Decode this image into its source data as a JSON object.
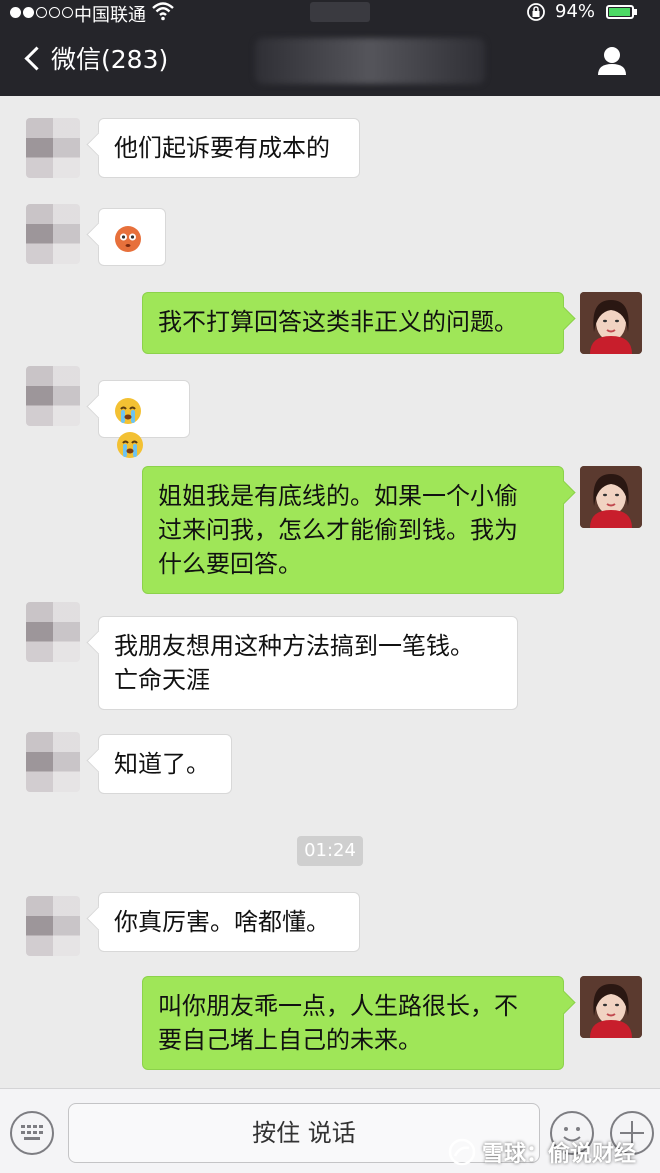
{
  "status_bar": {
    "carrier": "中国联通",
    "battery_percent": "94%",
    "battery_level": 0.94
  },
  "nav": {
    "back_label": "微信(283)"
  },
  "messages": [
    {
      "side": "left",
      "text": "他们起诉要有成本的"
    },
    {
      "side": "left",
      "emoji": [
        "flushed-face-emoji"
      ]
    },
    {
      "side": "right",
      "text": "我不打算回答这类非正义的问题。"
    },
    {
      "side": "left",
      "emoji": [
        "crying-face-emoji",
        "crying-face-emoji"
      ]
    },
    {
      "side": "right",
      "lines": [
        "姐姐我是有底线的。如果一个小偷",
        "过来问我，怎么才能偷到钱。我为",
        "什么要回答。"
      ]
    },
    {
      "side": "left",
      "lines": [
        "我朋友想用这种方法搞到一笔钱。",
        "亡命天涯"
      ]
    },
    {
      "side": "left",
      "text": "知道了。"
    },
    {
      "side": "left",
      "text": "你真厉害。啥都懂。"
    },
    {
      "side": "right",
      "lines": [
        "叫你朋友乖一点，人生路很长，不",
        "要自己堵上自己的未来。"
      ]
    }
  ],
  "timestamp": "01:24",
  "input_bar": {
    "hold_to_talk_label": "按住 说话"
  },
  "watermark": {
    "text": "雪球：偷说财经"
  },
  "colors": {
    "nav_bg": "#25252a",
    "chat_bg": "#ebebeb",
    "bubble_right": "#9fe658",
    "bubble_left": "#ffffff"
  }
}
